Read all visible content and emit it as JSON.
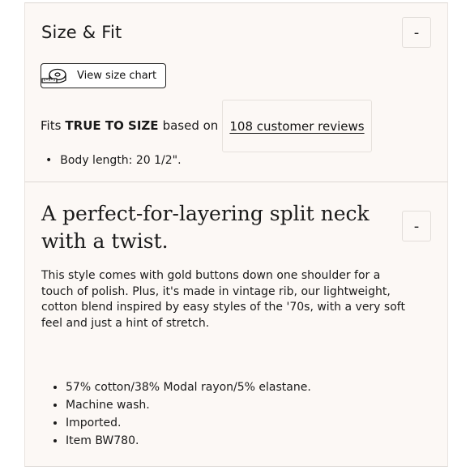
{
  "size_fit": {
    "title": "Size & Fit",
    "toggle_symbol": "-",
    "size_chart_label": "View size chart",
    "size_chart_icon": "measuring-tape-icon",
    "fits_prefix": "Fits",
    "fits_value": "TRUE TO SIZE",
    "fits_suffix": "based on",
    "reviews_link": "108 customer reviews",
    "body_length": "Body length: 20 1/2\"."
  },
  "details": {
    "headline": "A perfect-for-layering split neck with a twist.",
    "toggle_symbol": "-",
    "description": "This style comes with gold buttons down one shoulder for a touch of polish. Plus, it's made in vintage rib, our lightweight, cotton blend inspired by easy styles of the '70s, with a very soft feel and just a hint of stretch.",
    "features": [
      "57% cotton/38% Modal rayon/5% elastane.",
      "Machine wash.",
      "Imported.",
      "Item BW780."
    ]
  },
  "colors": {
    "panel_bg": "#fcf8f5",
    "text": "#1a1a1a",
    "border": "#dcd7d3"
  }
}
